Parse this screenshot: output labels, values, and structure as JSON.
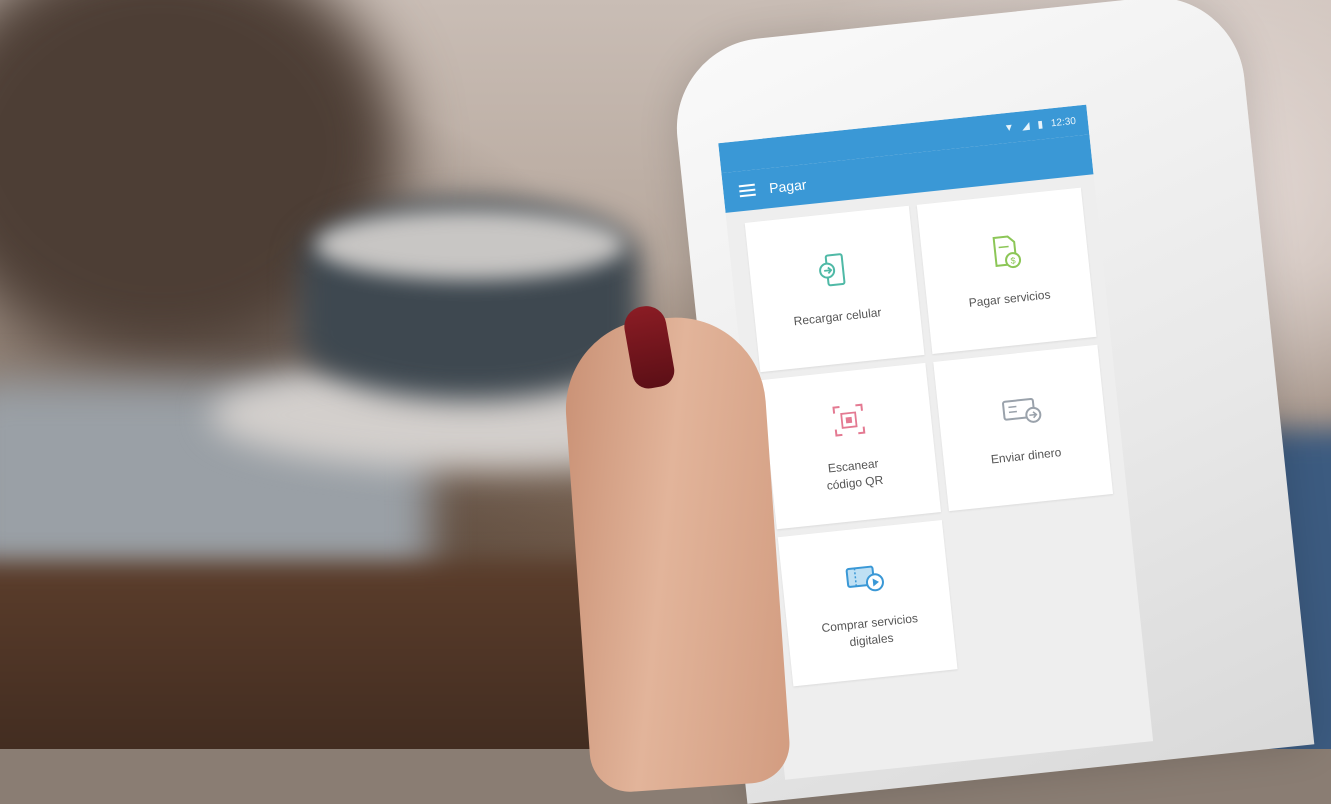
{
  "status": {
    "time": "12:30"
  },
  "appbar": {
    "title": "Pagar"
  },
  "tiles": [
    {
      "label": "Recargar celular",
      "icon": "phone-recharge-icon",
      "color": "#4fb9a6"
    },
    {
      "label": "Pagar servicios",
      "icon": "bill-pay-icon",
      "color": "#8cc657"
    },
    {
      "label": "Escanear\ncódigo QR",
      "icon": "qr-scan-icon",
      "color": "#e47a92"
    },
    {
      "label": "Enviar dinero",
      "icon": "send-money-icon",
      "color": "#9aa2ab"
    },
    {
      "label": "Comprar servicios\ndigitales",
      "icon": "digital-services-icon",
      "color": "#3a98d6"
    }
  ],
  "colors": {
    "accent": "#3a98d6",
    "nail": "#7a1820"
  }
}
